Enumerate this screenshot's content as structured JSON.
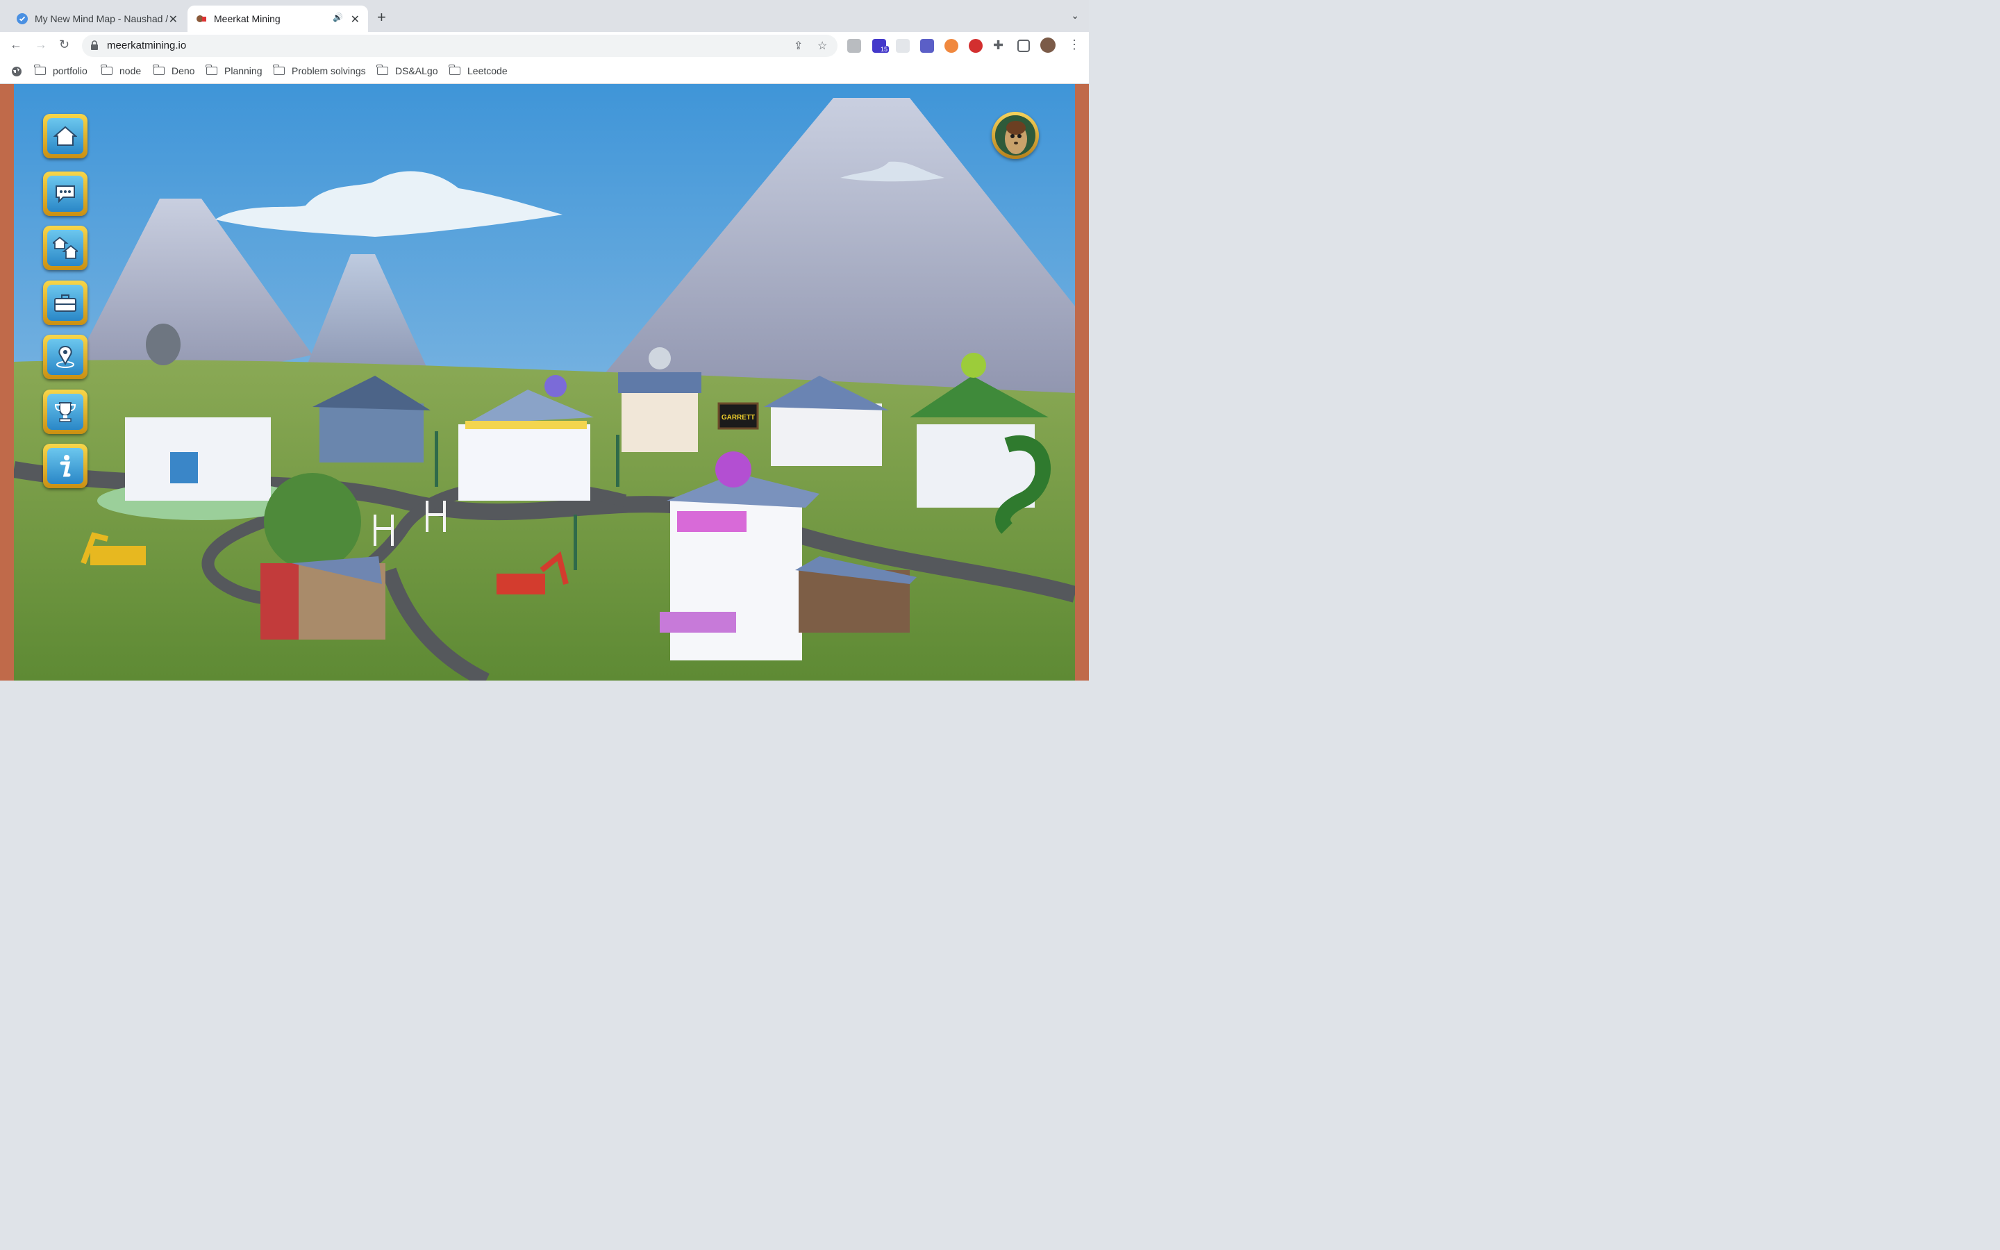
{
  "browser": {
    "tabs": [
      {
        "title": "My New Mind Map - Naushad /",
        "active": false
      },
      {
        "title": "Meerkat Mining",
        "active": true
      }
    ],
    "url": "meerkatmining.io",
    "extension_badge": "15",
    "bookmarks": [
      "portfolio",
      "node",
      "Deno",
      "Planning",
      "Problem solvings",
      "DS&ALgo",
      "Leetcode"
    ]
  },
  "game": {
    "sign_text": "GARRETT",
    "side_buttons": [
      "home-icon",
      "chat-icon",
      "houses-icon",
      "briefcase-icon",
      "location-pin-icon",
      "trophy-icon",
      "info-icon"
    ],
    "colors": {
      "sky_top": "#3f95d8",
      "sky_bottom": "#a9cde8",
      "grass": "#6f9a3f",
      "road": "#55585c",
      "button_gold": "#e9b62a",
      "button_blue": "#3fa2de"
    }
  }
}
